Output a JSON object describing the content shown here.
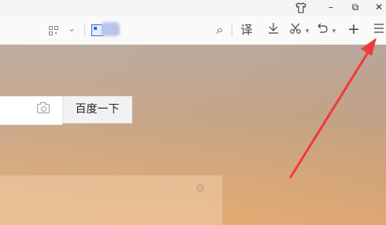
{
  "titlebar": {
    "skin_icon": "tshirt-icon",
    "minimize": "–",
    "restore": "⧉",
    "close": "✕"
  },
  "toolbar": {
    "qr_icon": "qr-code-icon",
    "dropdown": "⌄",
    "search_icon": "⌕",
    "translate": "译",
    "download": "⤓",
    "cut": "✂",
    "dropdown_small": "▾",
    "undo": "⤺",
    "dropdown_small2": "▾",
    "new_tab": "+",
    "menu": "☰",
    "blurred_title": "...设"
  },
  "page": {
    "search_button": "百度一下",
    "settings_icon": "⚙"
  },
  "colors": {
    "annotation_arrow": "#f03a3a"
  }
}
